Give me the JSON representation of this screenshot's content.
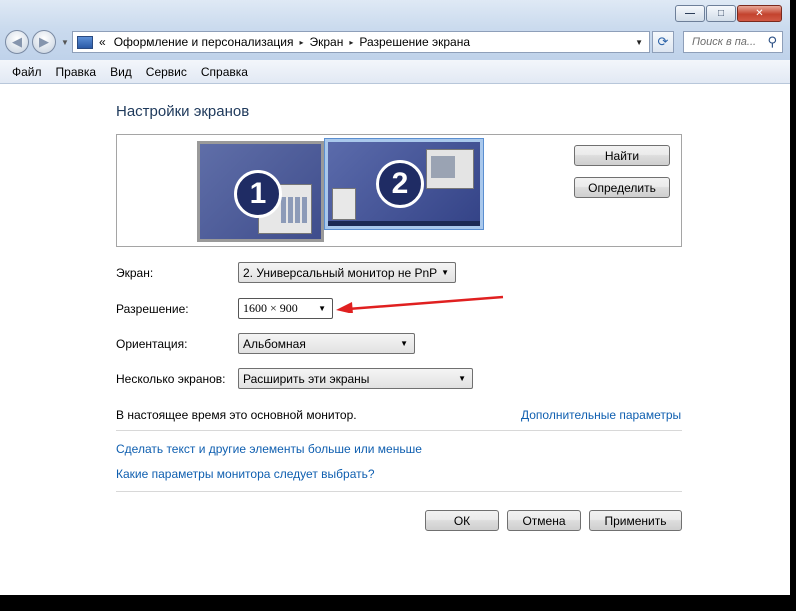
{
  "window": {
    "caption_buttons": {
      "minimize_icon": "minimize-icon",
      "maximize_icon": "maximize-icon",
      "close_icon": "close-icon",
      "min_glyph": "—",
      "max_glyph": "□",
      "close_glyph": "✕"
    }
  },
  "navigation": {
    "back_glyph": "◀",
    "forward_glyph": "▶",
    "breadcrumb_prefix": "«",
    "breadcrumb": [
      "Оформление и персонализация",
      "Экран",
      "Разрешение экрана"
    ],
    "separator": "▸",
    "dropdown": "▼",
    "refresh_glyph": "⟳",
    "search_placeholder": "Поиск в па...",
    "search_glyph": "⚲"
  },
  "menubar": {
    "items": [
      "Файл",
      "Правка",
      "Вид",
      "Сервис",
      "Справка"
    ]
  },
  "main": {
    "heading": "Настройки экранов",
    "monitors": [
      {
        "number": "1",
        "selected": false
      },
      {
        "number": "2",
        "selected": true
      }
    ],
    "find_button": "Найти",
    "identify_button": "Определить",
    "fields": {
      "display": {
        "label": "Экран:",
        "value": "2. Универсальный монитор не PnP"
      },
      "resolution": {
        "label": "Разрешение:",
        "value": "1600 × 900"
      },
      "orientation": {
        "label": "Ориентация:",
        "value": "Альбомная"
      },
      "multiple": {
        "label": "Несколько экранов:",
        "value": "Расширить эти экраны"
      }
    },
    "combo_arrow": "▼",
    "status_text": "В настоящее время это основной монитор.",
    "advanced_link": "Дополнительные параметры",
    "links": [
      "Сделать текст и другие элементы больше или меньше",
      "Какие параметры монитора следует выбрать?"
    ],
    "buttons": {
      "ok": "ОК",
      "cancel": "Отмена",
      "apply": "Применить"
    }
  },
  "colors": {
    "link": "#0f5fb0",
    "heading": "#1e395b",
    "annotation_arrow": "#e02020",
    "monitor_badge": "#1f2c64"
  }
}
